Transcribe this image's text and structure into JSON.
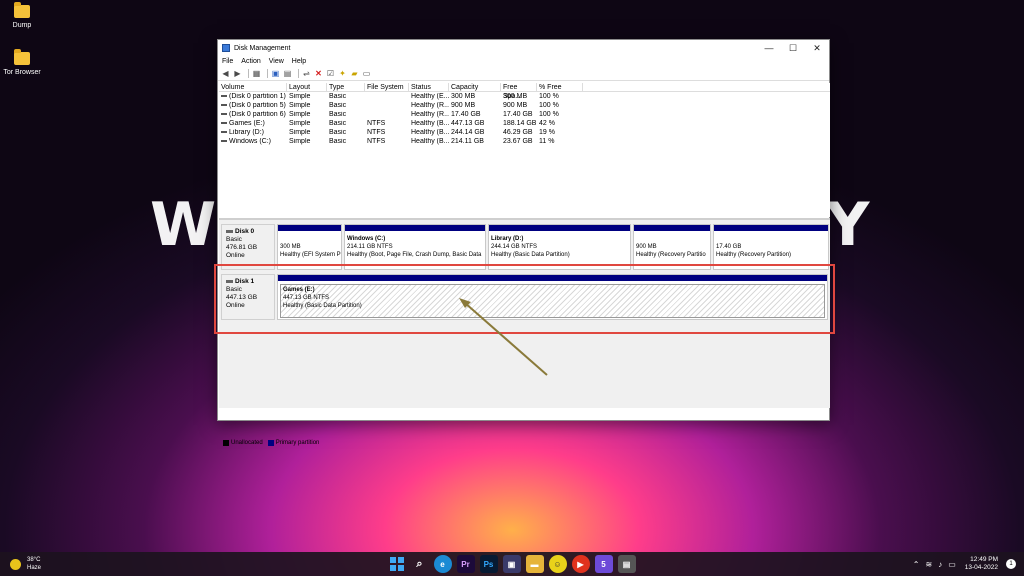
{
  "desktop": {
    "icons": [
      {
        "label": "Dump"
      },
      {
        "label": "Tor Browser"
      }
    ],
    "wallpaper_letters": [
      "W",
      "Y"
    ]
  },
  "window": {
    "title": "Disk Management",
    "menu": [
      "File",
      "Action",
      "View",
      "Help"
    ],
    "controls": {
      "minimize": "—",
      "maximize": "☐",
      "close": "✕"
    }
  },
  "volume_table": {
    "headers": [
      "Volume",
      "Layout",
      "Type",
      "File System",
      "Status",
      "Capacity",
      "Free Spa...",
      "% Free"
    ],
    "rows": [
      [
        "(Disk 0 partition 1)",
        "Simple",
        "Basic",
        "",
        "Healthy (E...",
        "300 MB",
        "300 MB",
        "100 %"
      ],
      [
        "(Disk 0 partition 5)",
        "Simple",
        "Basic",
        "",
        "Healthy (R...",
        "900 MB",
        "900 MB",
        "100 %"
      ],
      [
        "(Disk 0 partition 6)",
        "Simple",
        "Basic",
        "",
        "Healthy (R...",
        "17.40 GB",
        "17.40 GB",
        "100 %"
      ],
      [
        "Games (E:)",
        "Simple",
        "Basic",
        "NTFS",
        "Healthy (B...",
        "447.13 GB",
        "188.14 GB",
        "42 %"
      ],
      [
        "Library (D:)",
        "Simple",
        "Basic",
        "NTFS",
        "Healthy (B...",
        "244.14 GB",
        "46.29 GB",
        "19 %"
      ],
      [
        "Windows (C:)",
        "Simple",
        "Basic",
        "NTFS",
        "Healthy (B...",
        "214.11 GB",
        "23.67 GB",
        "11 %"
      ]
    ]
  },
  "disks": {
    "disk0": {
      "name": "Disk 0",
      "type": "Basic",
      "size": "476.81 GB",
      "status": "Online",
      "partitions": [
        {
          "name": "",
          "size": "300 MB",
          "status": "Healthy (EFI System P"
        },
        {
          "name": "Windows  (C:)",
          "size": "214.11 GB NTFS",
          "status": "Healthy (Boot, Page File, Crash Dump, Basic Data"
        },
        {
          "name": "Library  (D:)",
          "size": "244.14 GB NTFS",
          "status": "Healthy (Basic Data Partition)"
        },
        {
          "name": "",
          "size": "900 MB",
          "status": "Healthy (Recovery Partitio"
        },
        {
          "name": "",
          "size": "17.40 GB",
          "status": "Healthy (Recovery Partition)"
        }
      ]
    },
    "disk1": {
      "name": "Disk 1",
      "type": "Basic",
      "size": "447.13 GB",
      "status": "Online",
      "partitions": [
        {
          "name": "Games  (E:)",
          "size": "447.13 GB NTFS",
          "status": "Healthy (Basic Data Partition)"
        }
      ]
    }
  },
  "legend": {
    "unallocated": "Unallocated",
    "primary": "Primary partition"
  },
  "colors": {
    "primary_partition": "#000080",
    "unallocated": "#000000",
    "highlight": "#e0473f"
  },
  "taskbar": {
    "weather_temp": "38°C",
    "weather_desc": "Haze",
    "time": "12:49 PM",
    "date": "13-04-2022",
    "notification_count": "1"
  }
}
